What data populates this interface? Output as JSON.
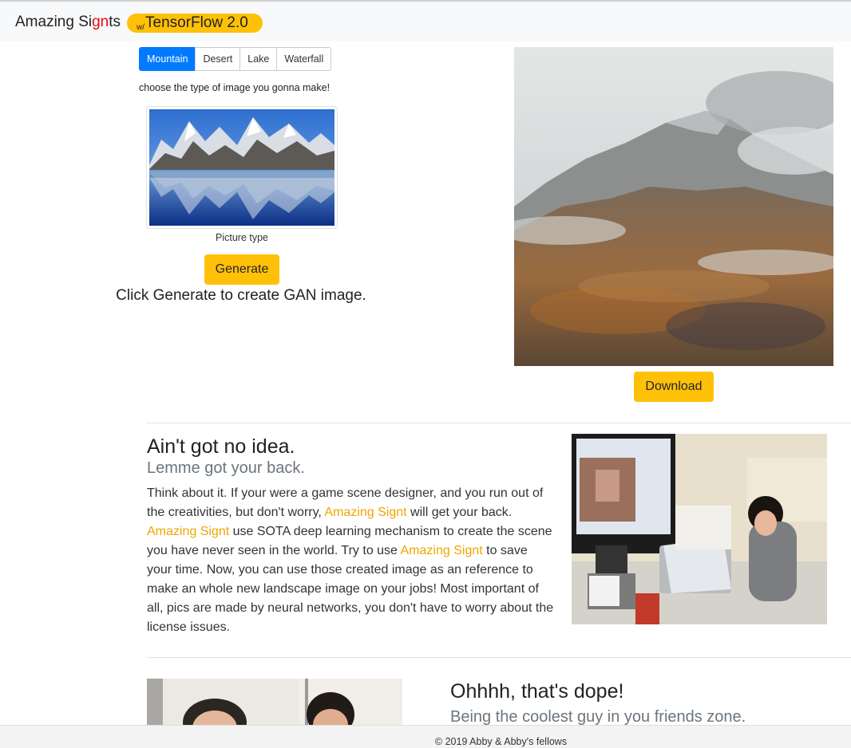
{
  "navbar": {
    "brand_part1": "Amazing Si",
    "brand_red": "gn",
    "brand_part2": "ts",
    "badge_prefix": "w/",
    "badge_text": "TensorFlow 2.0"
  },
  "generator": {
    "types": [
      "Mountain",
      "Desert",
      "Lake",
      "Waterfall"
    ],
    "selected_type": "Mountain",
    "hint": "choose the type of image you gonna make!",
    "thumbnail_caption": "Picture type",
    "generate_label": "Generate",
    "generate_hint": "Click Generate to create GAN image.",
    "download_label": "Download"
  },
  "section1": {
    "title": "Ain't got no idea.",
    "subtitle": "Lemme got your back.",
    "p1": "Think about it. If your were a game scene designer, and you run out of the creativities, but don't worry, ",
    "link1": "Amazing Signt",
    "p2": " will get your back. ",
    "link2": "Amazing Signt",
    "p3": " use SOTA deep learning mechanism to create the scene you have never seen in the world. Try to use ",
    "link3": "Amazing Signt",
    "p4": " to save your time. Now, you can use those created image as an reference to make an whole new landscape image on your jobs! Most important of all, pics are made by neural networks, you don't have to worry about the license issues."
  },
  "section2": {
    "title": "Ohhhh, that's dope!",
    "subtitle": "Being the coolest guy in you friends zone."
  },
  "footer": {
    "text": "© 2019 Abby & Abby's fellows"
  },
  "colors": {
    "accent_yellow": "#ffc107",
    "active_blue": "#007bff",
    "link_orange": "#f0a500",
    "brand_red": "#e01010"
  }
}
